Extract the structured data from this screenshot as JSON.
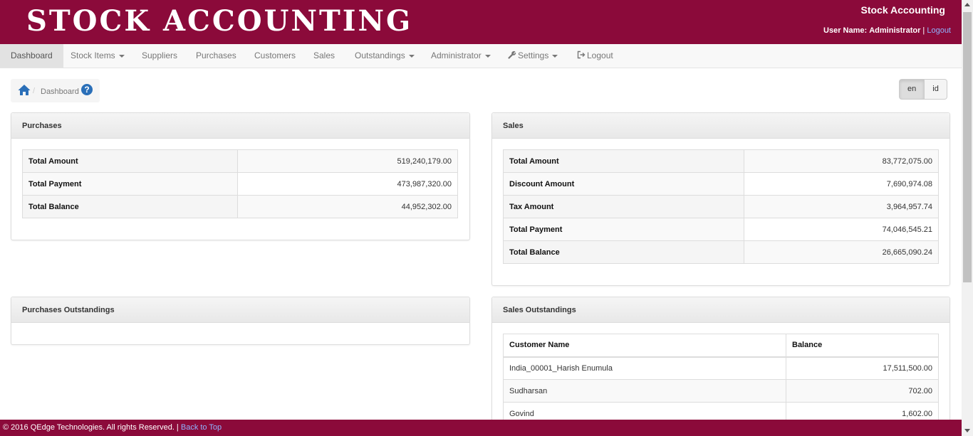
{
  "header": {
    "logo": "STOCK ACCOUNTING",
    "app_name": "Stock Accounting",
    "user_label": "User Name:",
    "user_name": "Administrator",
    "separator": "|",
    "logout_link": "Logout"
  },
  "nav": {
    "dashboard": "Dashboard",
    "stock_items": "Stock Items",
    "suppliers": "Suppliers",
    "purchases": "Purchases",
    "customers": "Customers",
    "sales": "Sales",
    "outstandings": "Outstandings",
    "administrator": "Administrator",
    "settings": "Settings",
    "logout": "Logout"
  },
  "breadcrumb": {
    "separator": "/",
    "current": "Dashboard",
    "help": "?"
  },
  "lang": {
    "en": "en",
    "id": "id"
  },
  "purchases": {
    "title": "Purchases",
    "rows": [
      {
        "label": "Total Amount",
        "value": "519,240,179.00"
      },
      {
        "label": "Total Payment",
        "value": "473,987,320.00"
      },
      {
        "label": "Total Balance",
        "value": "44,952,302.00"
      }
    ]
  },
  "sales": {
    "title": "Sales",
    "rows": [
      {
        "label": "Total Amount",
        "value": "83,772,075.00"
      },
      {
        "label": "Discount Amount",
        "value": "7,690,974.08"
      },
      {
        "label": "Tax Amount",
        "value": "3,964,957.74"
      },
      {
        "label": "Total Payment",
        "value": "74,046,545.21"
      },
      {
        "label": "Total Balance",
        "value": "26,665,090.24"
      }
    ]
  },
  "purchases_outstandings": {
    "title": "Purchases Outstandings"
  },
  "sales_outstandings": {
    "title": "Sales Outstandings",
    "columns": [
      "Customer Name",
      "Balance"
    ],
    "rows": [
      {
        "name": "India_00001_Harish Enumula",
        "balance": "17,511,500.00"
      },
      {
        "name": "Sudharsan",
        "balance": "702.00"
      },
      {
        "name": "Govind",
        "balance": "1,602.00"
      }
    ]
  },
  "footer": {
    "copyright": "© 2016 QEdge Technologies. All rights Reserved. |",
    "back_to_top": "Back to Top"
  },
  "colors": {
    "brand": "#8b0a3a",
    "link": "#8fb4ff",
    "help_icon": "#2a6fb8"
  }
}
